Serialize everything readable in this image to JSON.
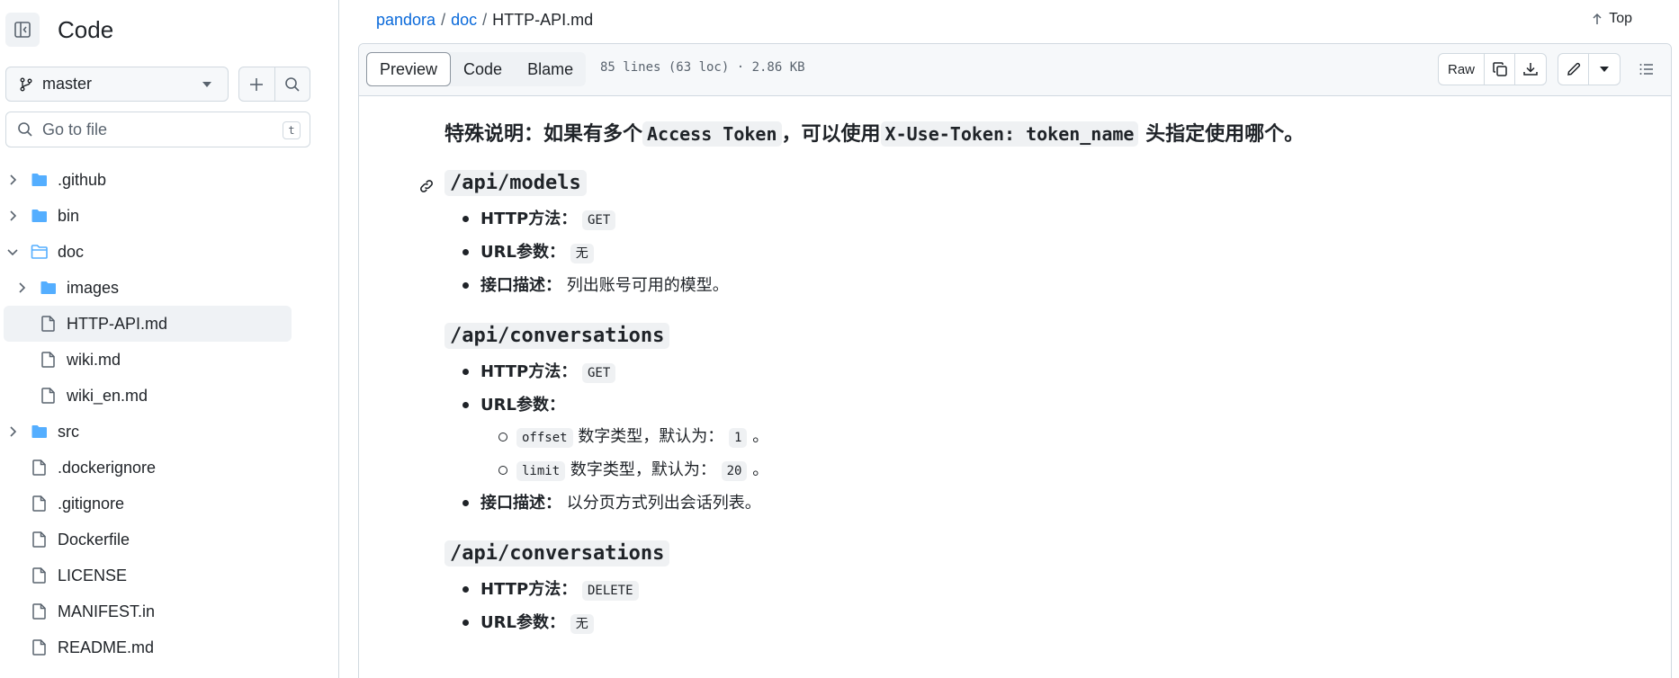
{
  "sidebar": {
    "title": "Code",
    "branch": "master",
    "search_placeholder": "Go to file",
    "search_shortcut": "t",
    "tree": [
      {
        "label": ".github",
        "type": "folder",
        "expanded": false
      },
      {
        "label": "bin",
        "type": "folder",
        "expanded": false
      },
      {
        "label": "doc",
        "type": "folder",
        "expanded": true
      },
      {
        "label": "images",
        "type": "folder",
        "expanded": false
      },
      {
        "label": "HTTP-API.md",
        "type": "file",
        "selected": true
      },
      {
        "label": "wiki.md",
        "type": "file"
      },
      {
        "label": "wiki_en.md",
        "type": "file"
      },
      {
        "label": "src",
        "type": "folder",
        "expanded": false
      },
      {
        "label": ".dockerignore",
        "type": "file"
      },
      {
        "label": ".gitignore",
        "type": "file"
      },
      {
        "label": "Dockerfile",
        "type": "file"
      },
      {
        "label": "LICENSE",
        "type": "file"
      },
      {
        "label": "MANIFEST.in",
        "type": "file"
      },
      {
        "label": "README.md",
        "type": "file"
      }
    ]
  },
  "breadcrumb": {
    "repo": "pandora",
    "dir": "doc",
    "file": "HTTP-API.md",
    "separator": "/"
  },
  "top_link": "Top",
  "file_header": {
    "tabs": [
      "Preview",
      "Code",
      "Blame"
    ],
    "active_tab": "Preview",
    "info": "85 lines (63 loc) · 2.86 KB",
    "raw_label": "Raw"
  },
  "content": {
    "note_prefix": "特殊说明：如果有多个",
    "note_code1": "Access Token",
    "note_mid": "，可以使用",
    "note_code2": "X-Use-Token: token_name",
    "note_suffix": "头指定使用哪个。",
    "sections": [
      {
        "heading": "/api/models",
        "method_label": "HTTP方法：",
        "method": "GET",
        "params_label": "URL参数：",
        "params_value": "无",
        "desc_label": "接口描述：",
        "desc": "列出账号可用的模型。"
      },
      {
        "heading": "/api/conversations",
        "method_label": "HTTP方法：",
        "method": "GET",
        "params_label": "URL参数：",
        "sub_params": [
          {
            "name": "offset",
            "text": "数字类型，默认为：",
            "default": "1",
            "end": "。"
          },
          {
            "name": "limit",
            "text": "数字类型，默认为：",
            "default": "20",
            "end": "。"
          }
        ],
        "desc_label": "接口描述：",
        "desc": "以分页方式列出会话列表。"
      },
      {
        "heading": "/api/conversations",
        "method_label": "HTTP方法：",
        "method": "DELETE",
        "params_label": "URL参数：",
        "params_value": "无"
      }
    ]
  },
  "colors": {
    "link": "#0969da",
    "folder": "#54aeff",
    "border": "#d1d9e0",
    "header_bg": "#f6f8fa",
    "selected_bg": "#eff2f5",
    "text": "#1f2328",
    "muted": "#59636e"
  }
}
